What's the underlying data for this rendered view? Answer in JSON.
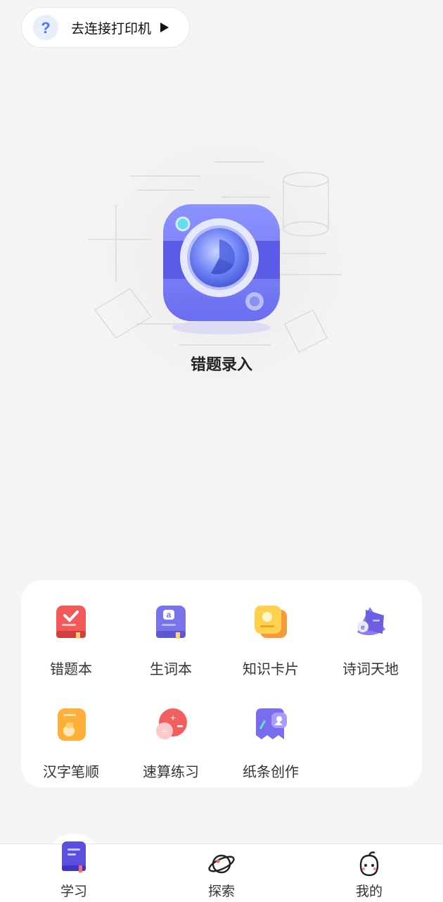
{
  "printer_bar": {
    "label": "去连接打印机",
    "icon": "question-icon"
  },
  "hero": {
    "label": "错题录入",
    "icon": "camera-icon"
  },
  "features": [
    {
      "label": "错题本",
      "icon": "mistake-book-icon"
    },
    {
      "label": "生词本",
      "icon": "vocab-book-icon"
    },
    {
      "label": "知识卡片",
      "icon": "knowledge-card-icon"
    },
    {
      "label": "诗词天地",
      "icon": "poetry-icon"
    },
    {
      "label": "汉字笔顺",
      "icon": "stroke-order-icon"
    },
    {
      "label": "速算练习",
      "icon": "quick-math-icon"
    },
    {
      "label": "纸条创作",
      "icon": "note-create-icon"
    }
  ],
  "tabs": [
    {
      "label": "学习",
      "icon": "book-icon",
      "active": true
    },
    {
      "label": "探索",
      "icon": "planet-icon",
      "active": false
    },
    {
      "label": "我的",
      "icon": "face-icon",
      "active": false
    }
  ],
  "colors": {
    "accent": "#6d6df0",
    "background": "#f5f5f5"
  }
}
